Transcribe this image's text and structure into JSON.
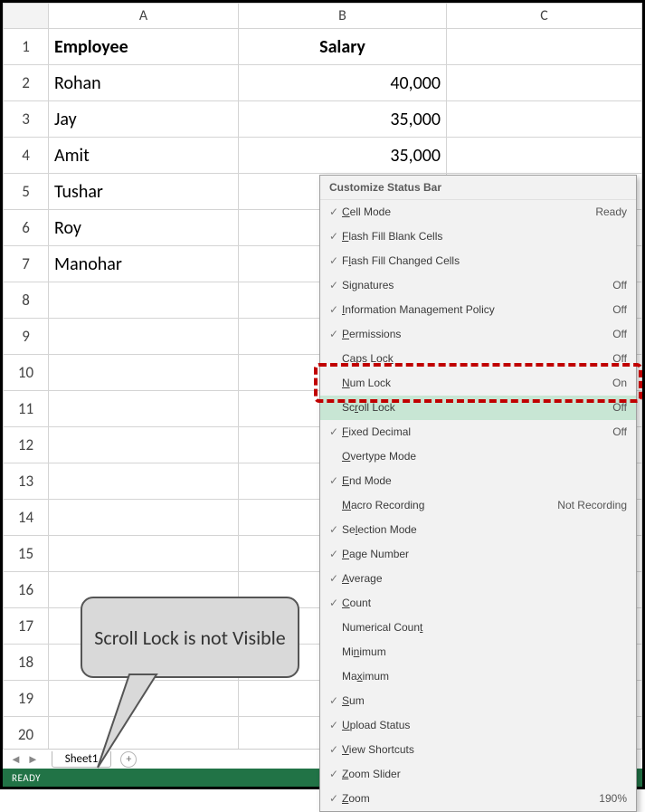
{
  "columns": {
    "a": "A",
    "b": "B",
    "c": "C"
  },
  "headers": {
    "employee": "Employee",
    "salary": "Salary"
  },
  "rows": [
    {
      "n": "1"
    },
    {
      "n": "2",
      "a": "Rohan",
      "b": "40,000"
    },
    {
      "n": "3",
      "a": "Jay",
      "b": "35,000"
    },
    {
      "n": "4",
      "a": "Amit",
      "b": "35,000"
    },
    {
      "n": "5",
      "a": "Tushar",
      "b": ""
    },
    {
      "n": "6",
      "a": "Roy",
      "b": ""
    },
    {
      "n": "7",
      "a": "Manohar",
      "b": ""
    },
    {
      "n": "8"
    },
    {
      "n": "9"
    },
    {
      "n": "10"
    },
    {
      "n": "11"
    },
    {
      "n": "12"
    },
    {
      "n": "13"
    },
    {
      "n": "14"
    },
    {
      "n": "15"
    },
    {
      "n": "16"
    },
    {
      "n": "17"
    },
    {
      "n": "18"
    },
    {
      "n": "19"
    },
    {
      "n": "20"
    }
  ],
  "tabs": {
    "sheet1": "Sheet1",
    "add": "+"
  },
  "status": {
    "ready": "READY"
  },
  "menu": {
    "title": "Customize Status Bar",
    "items": [
      {
        "chk": true,
        "pre": "",
        "u": "C",
        "post": "ell Mode",
        "state": "Ready"
      },
      {
        "chk": true,
        "pre": "",
        "u": "F",
        "post": "lash Fill Blank Cells",
        "state": ""
      },
      {
        "chk": true,
        "pre": "F",
        "u": "l",
        "post": "ash Fill Changed Cells",
        "state": ""
      },
      {
        "chk": true,
        "pre": "Si",
        "u": "g",
        "post": "natures",
        "state": "Off"
      },
      {
        "chk": true,
        "pre": "",
        "u": "I",
        "post": "nformation Management Policy",
        "state": "Off"
      },
      {
        "chk": true,
        "pre": "",
        "u": "P",
        "post": "ermissions",
        "state": "Off"
      },
      {
        "chk": false,
        "pre": "Caps Loc",
        "u": "k",
        "post": "",
        "state": "Off"
      },
      {
        "chk": false,
        "pre": "",
        "u": "N",
        "post": "um Lock",
        "state": "On"
      },
      {
        "chk": false,
        "pre": "Sc",
        "u": "r",
        "post": "oll Lock",
        "state": "Off",
        "highlight": true
      },
      {
        "chk": true,
        "pre": "",
        "u": "F",
        "post": "ixed Decimal",
        "state": "Off"
      },
      {
        "chk": false,
        "pre": "",
        "u": "O",
        "post": "vertype Mode",
        "state": ""
      },
      {
        "chk": true,
        "pre": "",
        "u": "E",
        "post": "nd Mode",
        "state": ""
      },
      {
        "chk": false,
        "pre": "",
        "u": "M",
        "post": "acro Recording",
        "state": "Not Recording"
      },
      {
        "chk": true,
        "pre": "Se",
        "u": "l",
        "post": "ection Mode",
        "state": ""
      },
      {
        "chk": true,
        "pre": "",
        "u": "P",
        "post": "age Number",
        "state": ""
      },
      {
        "chk": true,
        "pre": "",
        "u": "A",
        "post": "verage",
        "state": ""
      },
      {
        "chk": true,
        "pre": "",
        "u": "C",
        "post": "ount",
        "state": ""
      },
      {
        "chk": false,
        "pre": "Numerical Coun",
        "u": "t",
        "post": "",
        "state": ""
      },
      {
        "chk": false,
        "pre": "Mi",
        "u": "n",
        "post": "imum",
        "state": ""
      },
      {
        "chk": false,
        "pre": "Ma",
        "u": "x",
        "post": "imum",
        "state": ""
      },
      {
        "chk": true,
        "pre": "",
        "u": "S",
        "post": "um",
        "state": ""
      },
      {
        "chk": true,
        "pre": "",
        "u": "U",
        "post": "pload Status",
        "state": ""
      },
      {
        "chk": true,
        "pre": "",
        "u": "V",
        "post": "iew Shortcuts",
        "state": ""
      },
      {
        "chk": true,
        "pre": "",
        "u": "Z",
        "post": "oom Slider",
        "state": ""
      },
      {
        "chk": true,
        "pre": "",
        "u": "Z",
        "post": "oom",
        "state": "190%"
      }
    ]
  },
  "callout": {
    "text": "Scroll Lock is not Visible"
  }
}
